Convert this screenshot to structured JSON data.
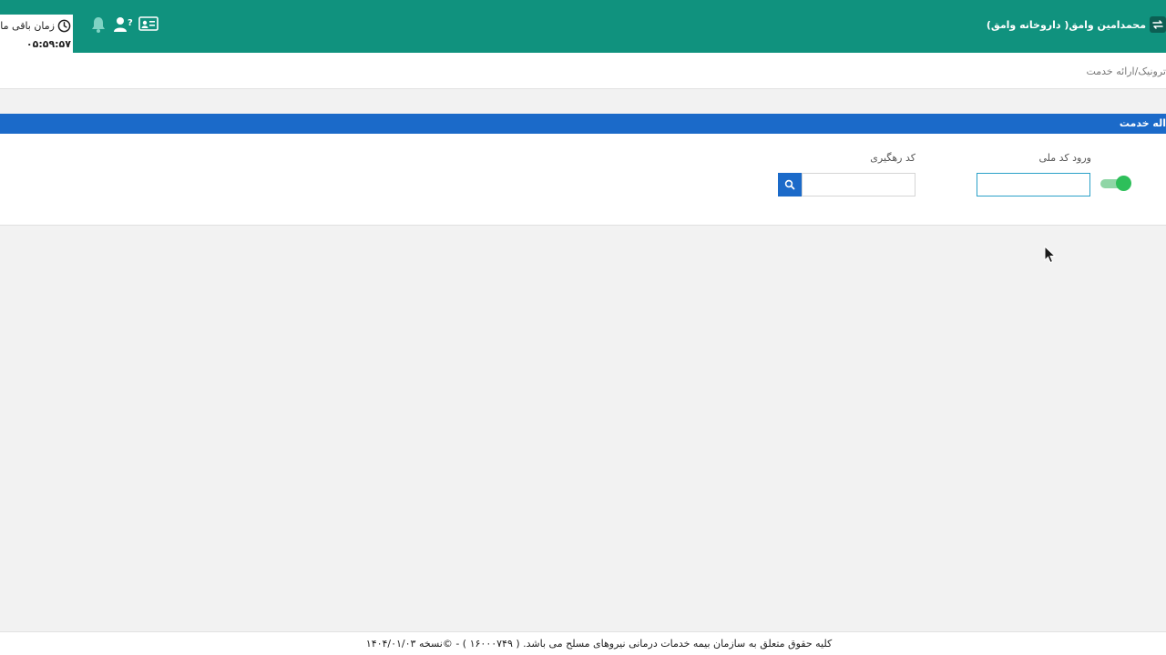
{
  "header": {
    "timer_label": "زمان باقی ما",
    "timer_value": "۰۵:۵۹:۵۷",
    "user_name": "محمدامین وامق( داروخانه وامق)",
    "colors": {
      "bar": "#10927e",
      "accent": "#1b6ac9"
    }
  },
  "breadcrumb": {
    "text": "ترونیک/ارائه خدمت"
  },
  "panel": {
    "title": "اله خدمت",
    "national_code_label": "ورود کد ملی",
    "national_code_value": "",
    "tracking_code_label": "کد رهگیری",
    "tracking_code_value": "",
    "toggle_on": true
  },
  "footer": {
    "text": "کلیه حقوق متعلق به سازمان بیمه خدمات درمانی نیروهای مسلح می باشد. ( ۱۶۰۰۰۷۴۹ ) - ©نسخه ۱۴۰۴/۰۱/۰۳"
  }
}
